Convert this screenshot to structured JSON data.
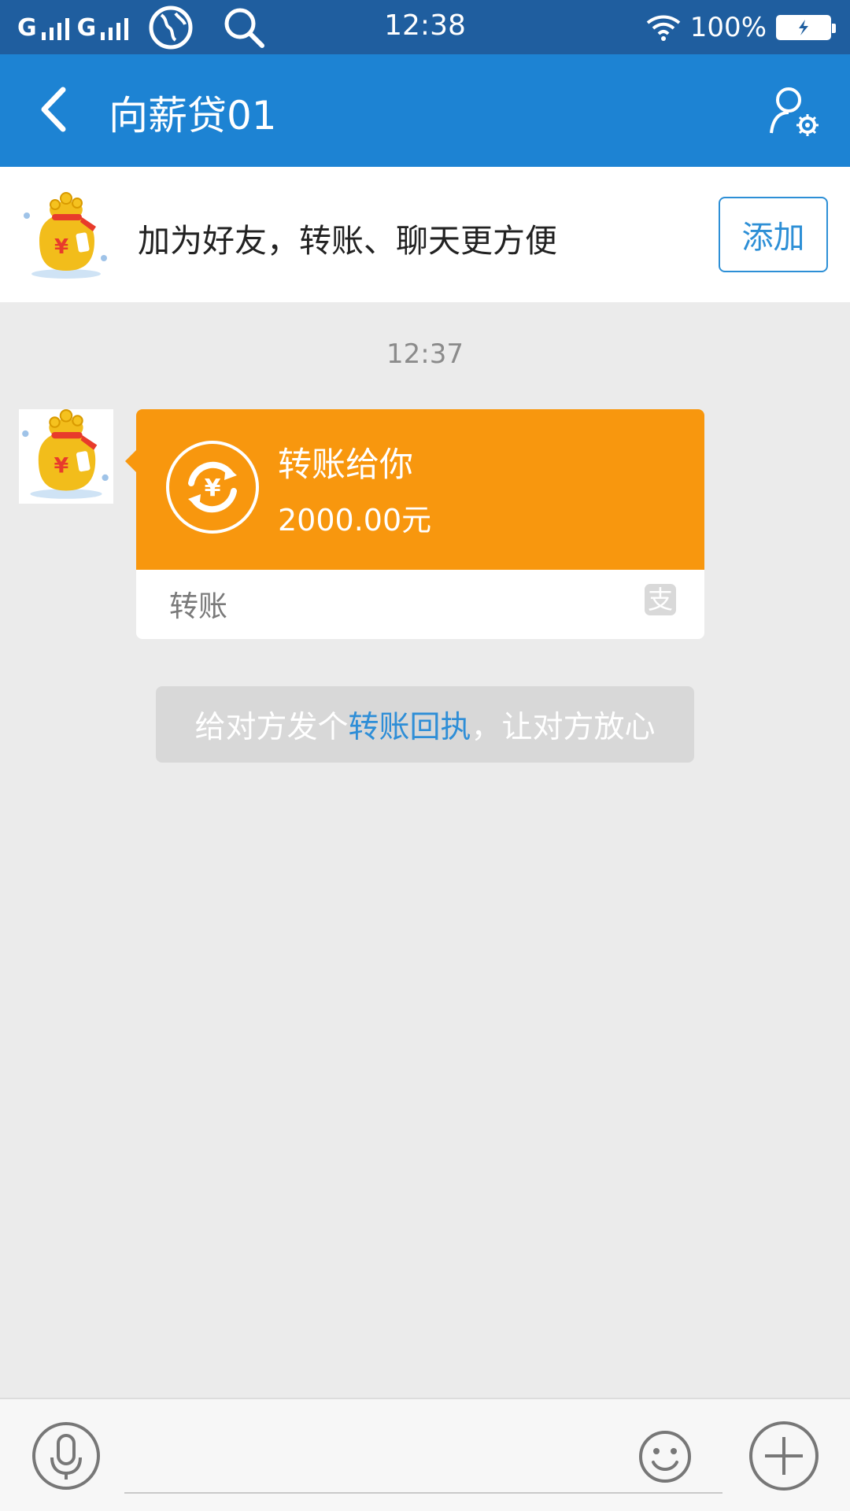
{
  "status_bar": {
    "carrier1": "G",
    "carrier2": "G",
    "time": "12:38",
    "battery": "100%",
    "icons": [
      "signal-icon",
      "globe-icon",
      "search-icon",
      "wifi-icon",
      "battery-icon"
    ]
  },
  "header": {
    "title": "向薪贷01",
    "icons": [
      "back-icon",
      "profile-settings-icon"
    ]
  },
  "banner": {
    "text": "加为好友，转账、聊天更方便",
    "add_label": "添加"
  },
  "chat": {
    "timestamp": "12:37",
    "transfer": {
      "title": "转账给你",
      "amount": "2000.00元",
      "type_label": "转账",
      "color": "#f8970e"
    },
    "tip": {
      "prefix": "给对方发个",
      "link": "转账回执",
      "suffix": "，让对方放心"
    }
  },
  "input_bar": {
    "placeholder": "",
    "icons": [
      "microphone-icon",
      "emoji-icon",
      "plus-icon"
    ]
  },
  "colors": {
    "status_bar": "#1f5e9f",
    "title_bar": "#1d83d3",
    "accent": "#2d8fd6",
    "transfer_orange": "#f8970e"
  }
}
